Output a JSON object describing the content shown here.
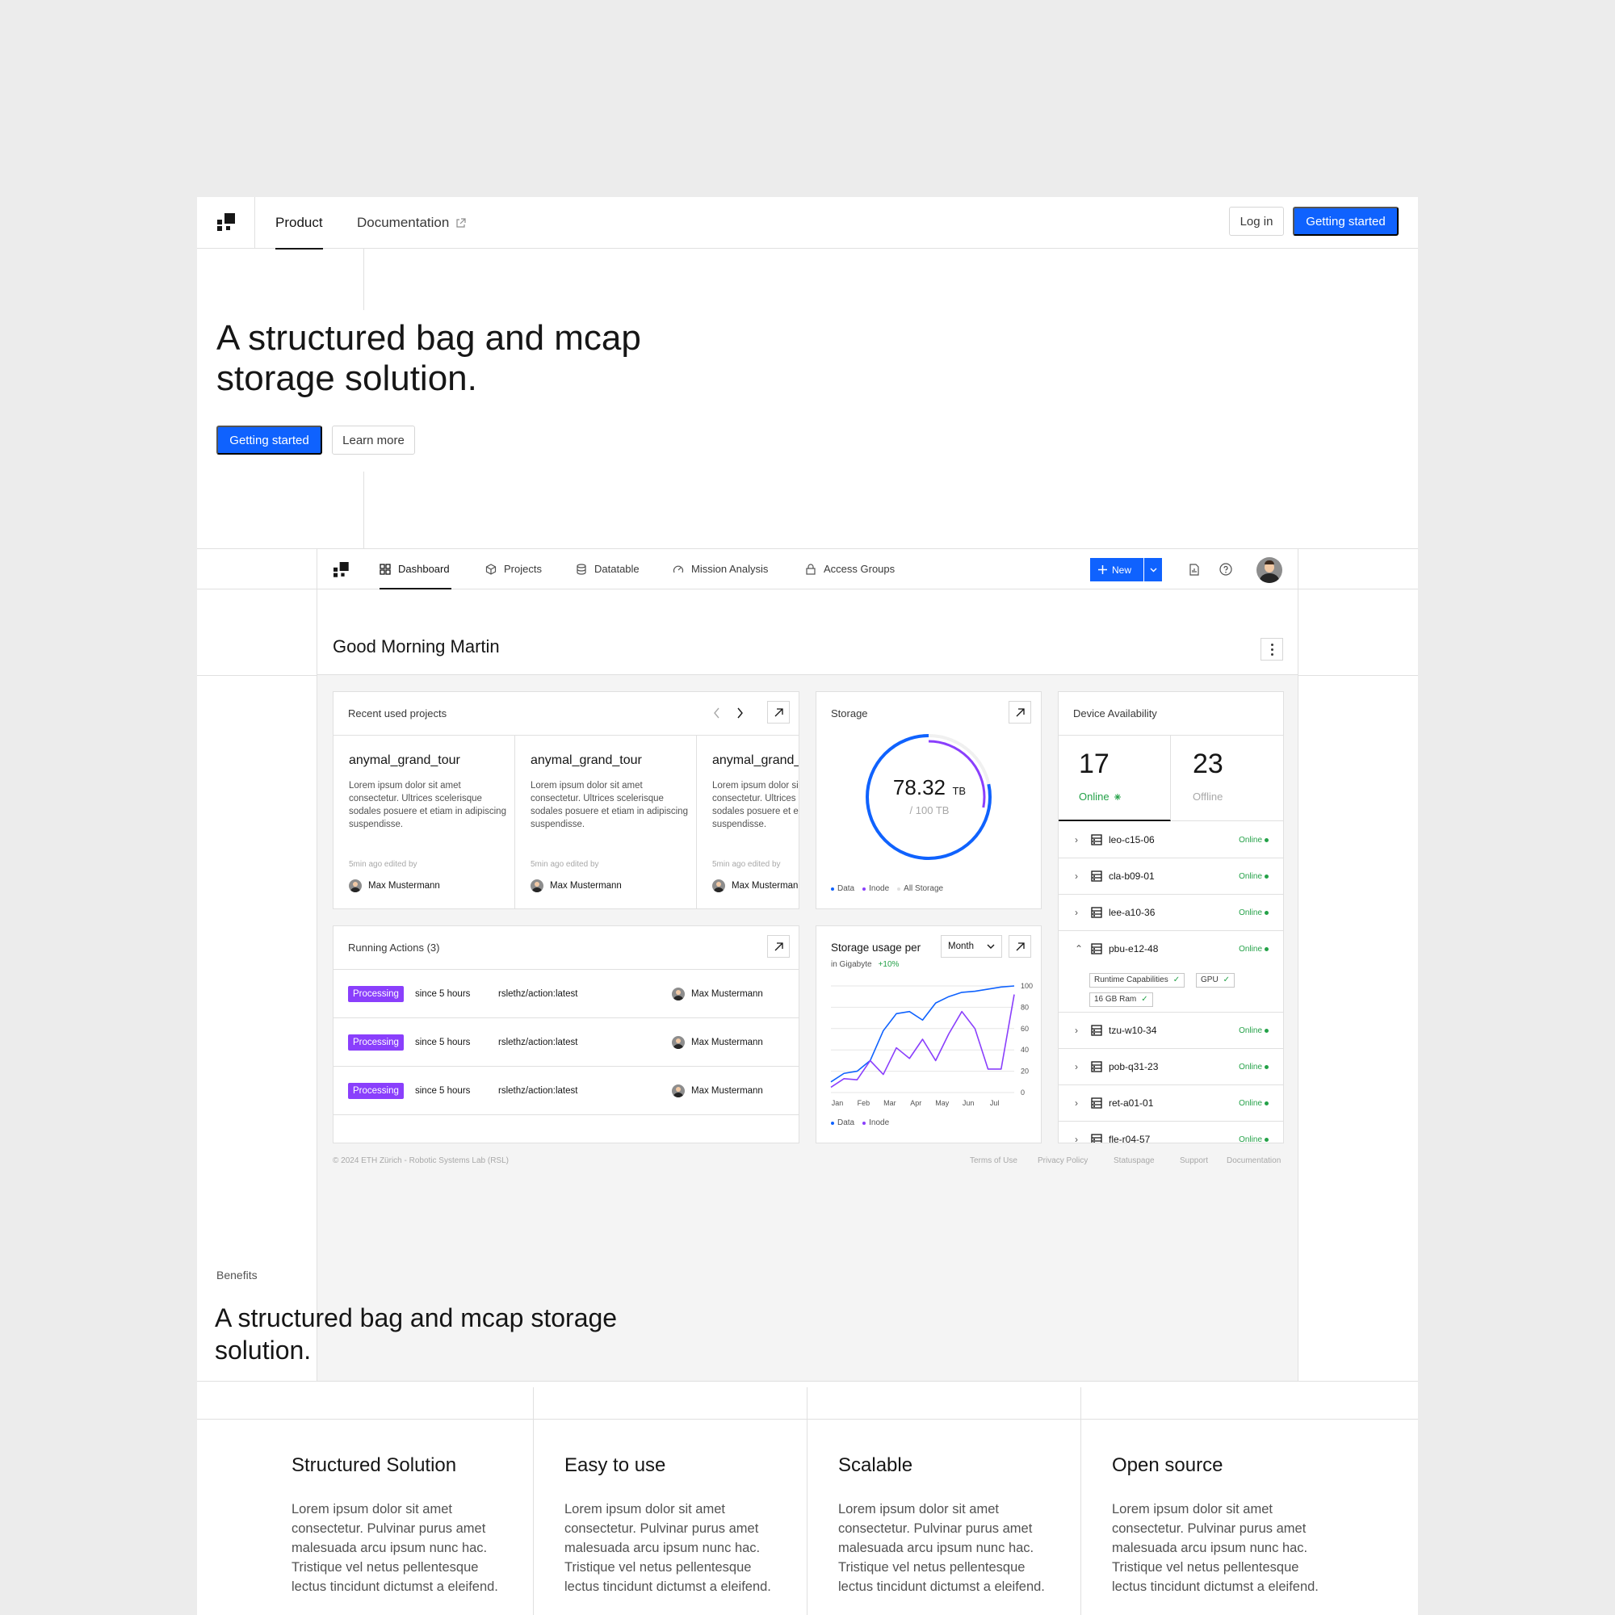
{
  "nav": {
    "tabs": [
      {
        "label": "Product",
        "active": true
      },
      {
        "label": "Documentation",
        "active": false
      }
    ],
    "login_label": "Log in",
    "cta_label": "Getting started"
  },
  "hero": {
    "title": "A structured bag and mcap storage solution.",
    "primary_label": "Getting started",
    "secondary_label": "Learn more"
  },
  "app": {
    "tabs": [
      {
        "label": "Dashboard",
        "icon": "grid-icon",
        "active": true
      },
      {
        "label": "Projects",
        "icon": "cube-icon",
        "active": false
      },
      {
        "label": "Datatable",
        "icon": "database-icon",
        "active": false
      },
      {
        "label": "Mission Analysis",
        "icon": "gauge-icon",
        "active": false
      },
      {
        "label": "Access Groups",
        "icon": "lock-icon",
        "active": false
      }
    ],
    "new_label": "New",
    "greeting": "Good Morning Martin",
    "recent": {
      "title": "Recent used projects",
      "projects": [
        {
          "name": "anymal_grand_tour",
          "desc": "Lorem ipsum dolor sit amet consectetur. Ultrices scelerisque sodales posuere et etiam in adipiscing suspendisse.",
          "meta": "5min ago edited by",
          "user": "Max Mustermann"
        },
        {
          "name": "anymal_grand_tour",
          "desc": "Lorem ipsum dolor sit amet consectetur. Ultrices scelerisque sodales posuere et etiam in adipiscing suspendisse.",
          "meta": "5min ago edited by",
          "user": "Max Mustermann"
        },
        {
          "name": "anymal_grand_tour",
          "desc": "Lorem ipsum dolor sit amet consectetur. Ultrices scelerisque sodales posuere et etiam in adipiscing suspendisse.",
          "meta": "5min ago edited by",
          "user": "Max Mustermann"
        }
      ]
    },
    "storage": {
      "title": "Storage",
      "value": "78.32",
      "unit": "TB",
      "total": "/ 100 TB",
      "data_fraction": 0.7832,
      "inode_fraction": 0.28,
      "legend": [
        "Data",
        "Inode",
        "All Storage"
      ]
    },
    "devices": {
      "title": "Device Availability",
      "online_count": "17",
      "online_label": "Online",
      "offline_count": "23",
      "offline_label": "Offline",
      "rows": [
        {
          "name": "leo-c15-06",
          "status": "Online",
          "expanded": false
        },
        {
          "name": "cla-b09-01",
          "status": "Online",
          "expanded": false
        },
        {
          "name": "lee-a10-36",
          "status": "Online",
          "expanded": false
        },
        {
          "name": "pbu-e12-48",
          "status": "Online",
          "expanded": true
        },
        {
          "name": "tzu-w10-34",
          "status": "Online",
          "expanded": false
        },
        {
          "name": "pob-q31-23",
          "status": "Online",
          "expanded": false
        },
        {
          "name": "ret-a01-01",
          "status": "Online",
          "expanded": false
        },
        {
          "name": "fle-r04-57",
          "status": "Online",
          "expanded": false
        }
      ],
      "capabilities": [
        "Runtime Capabilities",
        "GPU",
        "16 GB Ram"
      ]
    },
    "actions": {
      "title": "Running Actions (3)",
      "rows": [
        {
          "status": "Processing",
          "since": "since 5 hours",
          "action": "rslethz/action:latest",
          "user": "Max Mustermann"
        },
        {
          "status": "Processing",
          "since": "since 5 hours",
          "action": "rslethz/action:latest",
          "user": "Max Mustermann"
        },
        {
          "status": "Processing",
          "since": "since 5 hours",
          "action": "rslethz/action:latest",
          "user": "Max Mustermann"
        }
      ]
    },
    "usage": {
      "title": "Storage usage per",
      "select_value": "Month",
      "subtitle": "in Gigabyte",
      "delta": "+10%"
    },
    "footer": {
      "copyright": "© 2024 ETH Zürich - Robotic Systems Lab (RSL)",
      "links": [
        "Terms of Use",
        "Privacy Policy",
        "Statuspage",
        "Support",
        "Documentation"
      ]
    }
  },
  "chart_data": {
    "type": "line",
    "categories": [
      "Jan",
      "Feb",
      "Mar",
      "Apr",
      "May",
      "Jun",
      "Jul"
    ],
    "x": [
      0,
      0.5,
      1,
      1.5,
      2,
      2.5,
      3,
      3.5,
      4,
      4.5,
      5,
      5.5,
      6,
      6.5,
      7
    ],
    "series": [
      {
        "name": "Data",
        "color": "#0f62fe",
        "values": [
          10,
          18,
          20,
          30,
          58,
          74,
          76,
          68,
          84,
          90,
          94,
          95,
          97,
          99,
          100
        ]
      },
      {
        "name": "Inode",
        "color": "#8a3ffc",
        "values": [
          5,
          13,
          12,
          30,
          17,
          42,
          32,
          50,
          30,
          55,
          76,
          60,
          22,
          22,
          92
        ]
      }
    ],
    "yticks": [
      0,
      20,
      40,
      60,
      80,
      100
    ],
    "ylim": [
      0,
      100
    ],
    "grid": true,
    "legend": "bottom-left"
  },
  "benefits": {
    "eyebrow": "Benefits",
    "title": "A structured bag and mcap storage solution.",
    "items": [
      {
        "title": "Structured Solution",
        "text": "Lorem ipsum dolor sit amet consectetur. Pulvinar purus amet malesuada arcu ipsum nunc hac. Tristique vel netus pellentesque lectus tincidunt dictumst a eleifend."
      },
      {
        "title": "Easy to use",
        "text": "Lorem ipsum dolor sit amet consectetur. Pulvinar purus amet malesuada arcu ipsum nunc hac. Tristique vel netus pellentesque lectus tincidunt dictumst a eleifend."
      },
      {
        "title": "Scalable",
        "text": "Lorem ipsum dolor sit amet consectetur. Pulvinar purus amet malesuada arcu ipsum nunc hac. Tristique vel netus pellentesque lectus tincidunt dictumst a eleifend."
      },
      {
        "title": "Open source",
        "text": "Lorem ipsum dolor sit amet consectetur. Pulvinar purus amet malesuada arcu ipsum nunc hac. Tristique vel netus pellentesque lectus tincidunt dictumst a eleifend."
      }
    ]
  }
}
